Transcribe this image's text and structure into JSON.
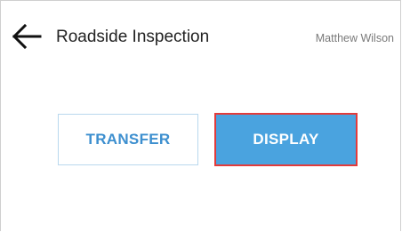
{
  "header": {
    "title": "Roadside Inspection",
    "user_name": "Matthew Wilson",
    "back_icon": "arrow-left-icon"
  },
  "actions": {
    "transfer_label": "TRANSFER",
    "display_label": "DISPLAY"
  },
  "colors": {
    "accent": "#4aa3df",
    "transfer_text": "#3d8fcf",
    "highlight_border": "#e23b3b"
  }
}
